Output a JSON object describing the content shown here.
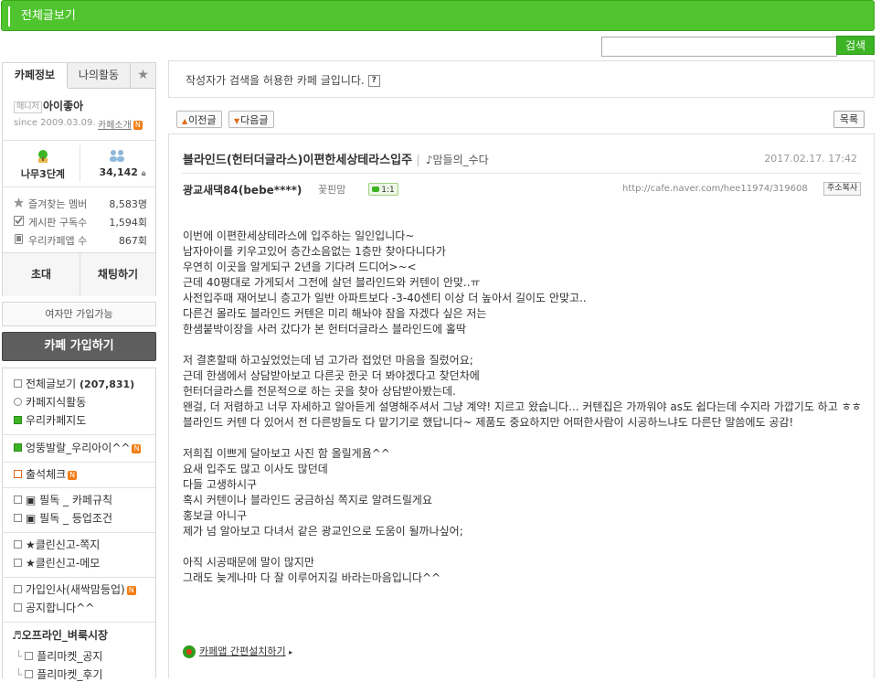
{
  "topbar": {
    "all_posts": "전체글보기"
  },
  "search": {
    "button": "검색",
    "value": ""
  },
  "sidebar": {
    "tabs": [
      "카페정보",
      "나의활동",
      "★"
    ],
    "manager_badge": "매니저",
    "manager_name": "아이좋아",
    "since": "since 2009.03.09.",
    "cafe_intro": "카페소개",
    "level": "나무3단계",
    "members": "34,142",
    "stats": [
      {
        "label": "즐겨찾는 멤버",
        "value": "8,583명"
      },
      {
        "label": "게시판 구독수",
        "value": "1,594회"
      },
      {
        "label": "우리카페앱 수",
        "value": "867회"
      }
    ],
    "invite": "초대",
    "chat": "채팅하기",
    "women_only": "여자만 가입가능",
    "join": "카페 가입하기",
    "menu": [
      {
        "label": "전체글보기",
        "count": "(207,831)"
      },
      {
        "label": "카페지식활동"
      },
      {
        "label": "우리카페지도"
      },
      {
        "label": "엉뚱발랄_우리아이^^"
      },
      {
        "label": "출석체크"
      },
      {
        "label": "▣ 필독 _ 카페규칙"
      },
      {
        "label": "▣ 필독 _ 등업조건"
      },
      {
        "label": "★클린신고-쪽지"
      },
      {
        "label": "★클린신고-메모"
      },
      {
        "label": "가입인사(새싹맘등업)"
      },
      {
        "label": "공지합니다^^"
      },
      {
        "label": "♬오프라인_벼룩시장"
      },
      {
        "label": "플리마켓_공지"
      },
      {
        "label": "플리마켓_후기"
      }
    ]
  },
  "notice": {
    "text": "작성자가 검색을 허용한 카페 글입니다.",
    "help": "?"
  },
  "nav": {
    "prev": "이전글",
    "next": "다음글",
    "list": "목록"
  },
  "post": {
    "title": "블라인드(헌터더글라스)이편한세상테라스입주",
    "board": "♪맘들의_수다",
    "date": "2017.02.17. 17:42",
    "author": "광교새댁84(bebe****)",
    "level": "꽃핀맘",
    "comments": "1:1",
    "url": "http://cafe.naver.com/hee11974/319608",
    "copy": "주소복사",
    "paragraphs": [
      [
        "이번에 이편한세상테라스에 입주하는 일인입니다~",
        "남자아이를 키우고있어 층간소음없는 1층만 찾아다니다가",
        "우연히 이곳을 알게되구 2년을 기다려 드디어>~<",
        "근데 40평대로 가게되서 그전에 살던 블라인드와 커텐이 안맞..ㅠ",
        "사전입주때 재어보니 층고가 일반 아파트보다 -3-40센티 이상 더 높아서 길이도 안맞고..",
        "다른건 몰라도 블라인드 커텐은 미리 해놔야 잠을 자겠다 싶은 저는",
        "한샘붙박이장을 사러 갔다가 본 헌터더글라스 블라인드에 홀딱"
      ],
      [
        "저 결혼할때 하고싶었었는데 넘 고가라 접었던 마음을 질렀어요;",
        "근데 한샘에서 상담받아보고 다른곳 한곳 더 봐야겠다고 찾던차에",
        "헌터더글라스를 전문적으로 하는 곳을 찾아 상담받아봤는데.",
        "왠걸, 더 저렴하고 너무 자세하고 알아듣게 설명해주셔서 그냥 계약! 지르고 왔습니다... 커텐집은 가까워야 as도 쉽다는데 수지라 가깝기도 하고 ㅎㅎ블라인드 커텐 다 있어서 전 다른방들도 다 맡기기로 했답니다~ 제품도 중요하지만 어떠한사람이 시공하느냐도 다른단 말씀에도 공감!"
      ],
      [
        "저희집 이쁘게 달아보고 사진 함 올릴게욤^^",
        "요새 입주도 많고 이사도 많던데",
        "다들 고생하시구",
        "혹시 커텐이나 블라인드 궁금하심 쪽지로 알려드릴게요",
        "홍보글 아니구",
        "제가 넘 알아보고 다녀서 같은 광교인으로 도움이 될까나싶어;"
      ],
      [
        "아직 시공때문에 말이 많지만",
        "그래도 늦게나마 다 잘 이루어지길 바라는마음입니다^^"
      ]
    ],
    "app_link": "카페앱 간편설치하기"
  },
  "colors": {
    "brand_green": "#4fc42e",
    "orange": "#f27c14"
  }
}
